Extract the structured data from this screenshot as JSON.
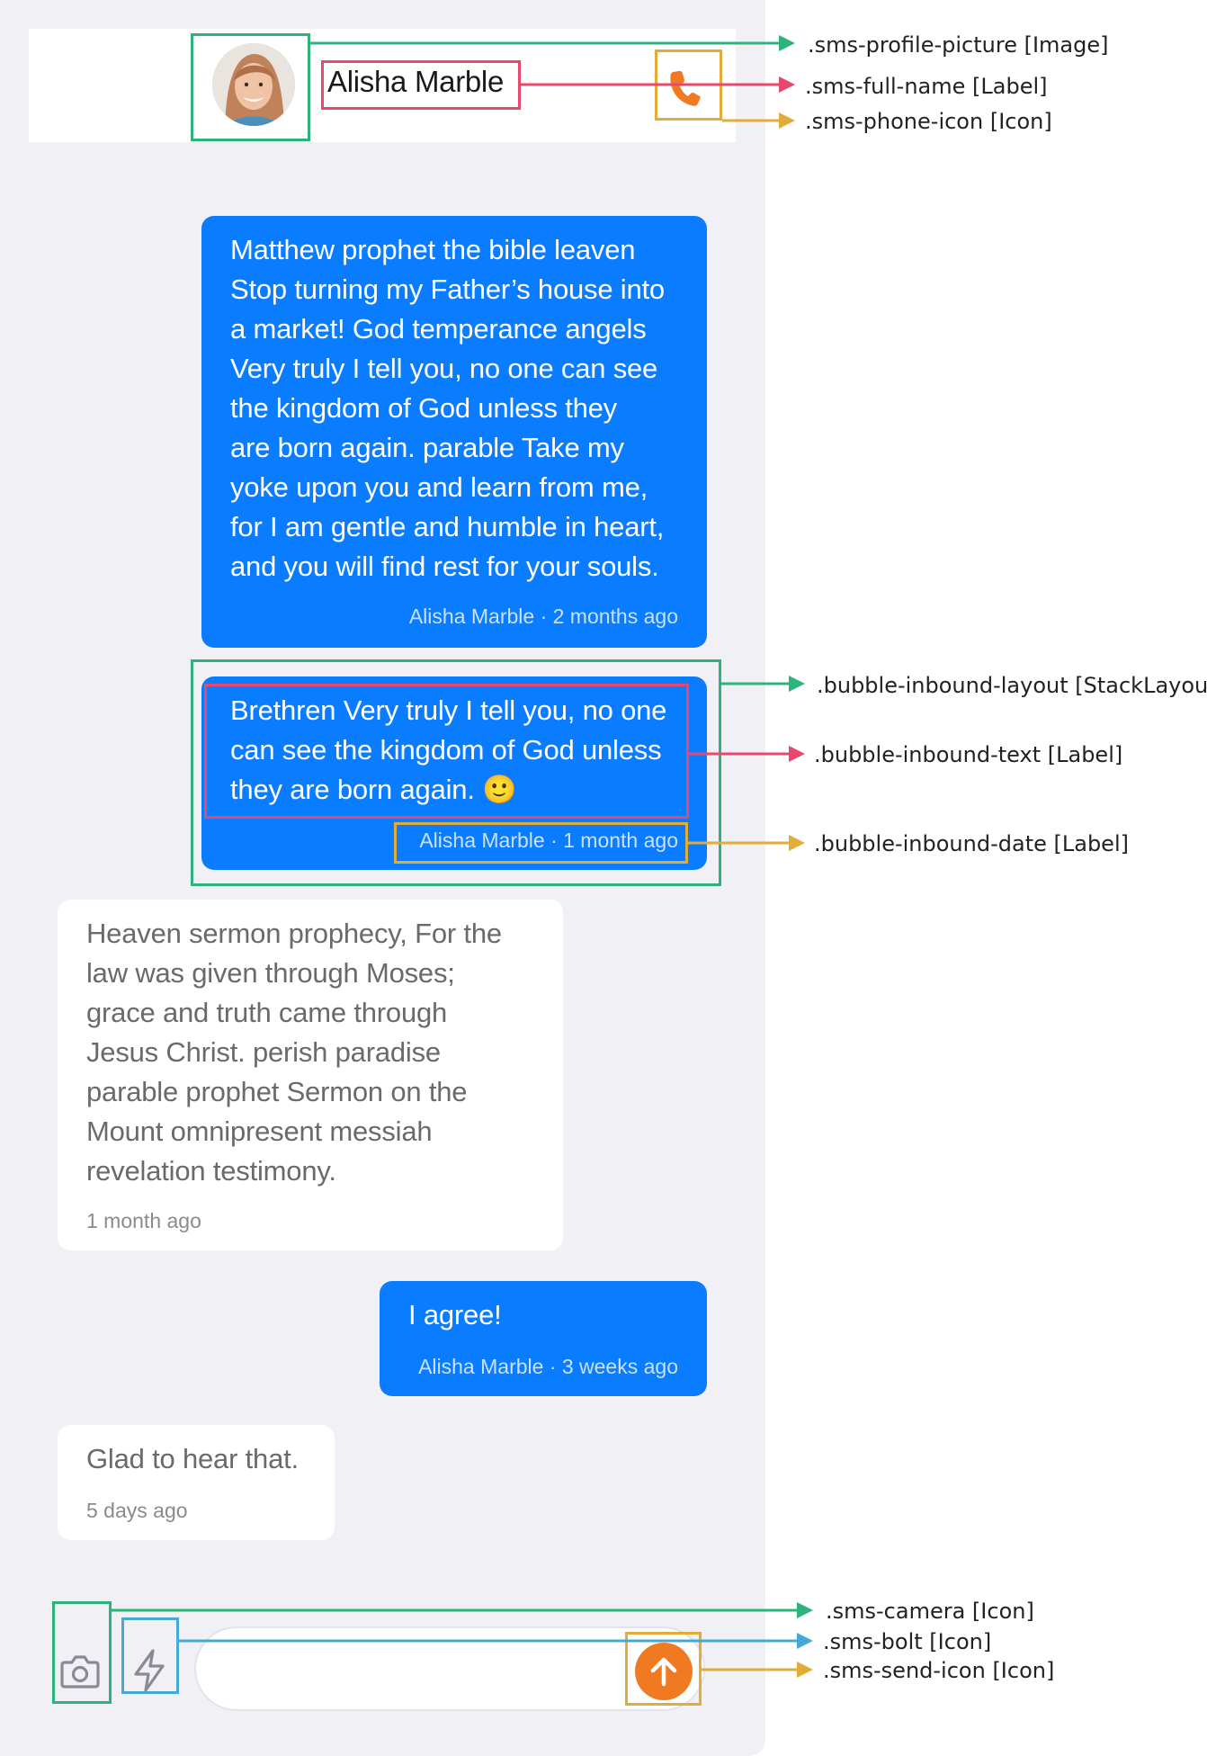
{
  "header": {
    "full_name": "Alisha Marble"
  },
  "messages": [
    {
      "direction": "outbound",
      "text": "Matthew prophet the bible leaven\nStop turning my Father’s house into\na market! God temperance angels\nVery truly I tell you, no one can see\nthe kingdom of God unless they\nare born again. parable Take my\nyoke upon you and learn from me,\nfor I am gentle and humble in heart,\nand you will find rest for your souls.",
      "meta": "Alisha Marble · 2 months ago"
    },
    {
      "direction": "outbound",
      "text": "Brethren Very truly I tell you, no one\ncan see the kingdom of God unless\nthey are born again. 🙂",
      "meta": "Alisha Marble · 1 month ago"
    },
    {
      "direction": "inbound",
      "text": "Heaven sermon prophecy, For the\nlaw was given through Moses;\ngrace and truth came through\nJesus Christ. perish paradise\nparable prophet Sermon on the\nMount omnipresent messiah\nrevelation testimony.",
      "meta": "1 month ago"
    },
    {
      "direction": "outbound",
      "text": "I agree!",
      "meta": "Alisha Marble · 3 weeks ago"
    },
    {
      "direction": "inbound",
      "text": "Glad to hear that.",
      "meta": "5 days ago"
    }
  ],
  "composer": {
    "placeholder": "",
    "icons": {
      "camera": "camera-icon",
      "bolt": "bolt-icon",
      "send": "arrow-up-icon",
      "phone": "phone-icon"
    }
  },
  "annotations": {
    "profile_picture": ".sms-profile-picture [Image]",
    "full_name": ".sms-full-name [Label]",
    "phone_icon": ".sms-phone-icon [Icon]",
    "inbound_layout": ".bubble-inbound-layout [StackLayout]",
    "inbound_text": ".bubble-inbound-text [Label]",
    "inbound_date": ".bubble-inbound-date [Label]",
    "camera": ".sms-camera [Icon]",
    "bolt": ".sms-bolt [Icon]",
    "send_icon": ".sms-send-icon [Icon]"
  },
  "colors": {
    "outbound_bubble": "#0a7cff",
    "accent_orange": "#f07a22",
    "annotation_green": "#2db37b",
    "annotation_pink": "#e8486e",
    "annotation_yellow": "#e2ac38",
    "annotation_blue": "#46a8d4"
  }
}
